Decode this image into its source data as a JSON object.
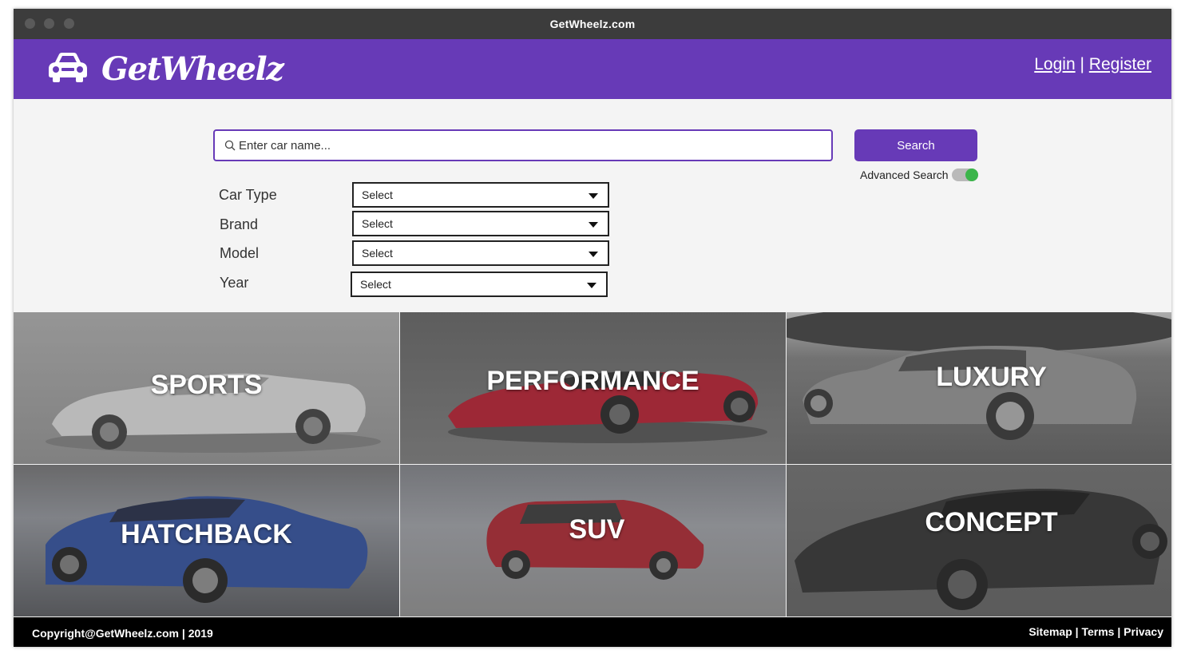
{
  "window": {
    "title": "GetWheelz.com"
  },
  "header": {
    "brand": "GetWheelz",
    "login_label": "Login",
    "separator": "|",
    "register_label": "Register"
  },
  "search": {
    "placeholder": "Enter car name...",
    "button_label": "Search",
    "advanced_label": "Advanced Search",
    "advanced_enabled": true
  },
  "filters": [
    {
      "label": "Car Type",
      "value": "Select"
    },
    {
      "label": "Brand",
      "value": "Select"
    },
    {
      "label": "Model",
      "value": "Select"
    },
    {
      "label": "Year",
      "value": "Select"
    }
  ],
  "categories": [
    {
      "label": "SPORTS",
      "car_color": "#e8e8e8"
    },
    {
      "label": "PERFORMANCE",
      "car_color": "#c0192b"
    },
    {
      "label": "LUXURY",
      "car_color": "#8a8a8a"
    },
    {
      "label": "HATCHBACK",
      "car_color": "#2a4a9a"
    },
    {
      "label": "SUV",
      "car_color": "#c0192b"
    },
    {
      "label": "CONCEPT",
      "car_color": "#2b2b2b"
    }
  ],
  "footer": {
    "copyright": "Copyright@GetWheelz.com | 2019",
    "sitemap": "Sitemap",
    "terms": "Terms",
    "privacy": "Privacy",
    "separator": "|"
  },
  "colors": {
    "brand_purple": "#673ab7",
    "titlebar": "#3c3c3c",
    "toggle_on": "#3bb54a",
    "footer_bg": "#000000"
  },
  "icons": [
    "car-logo-icon",
    "search-icon",
    "chevron-down-icon"
  ]
}
